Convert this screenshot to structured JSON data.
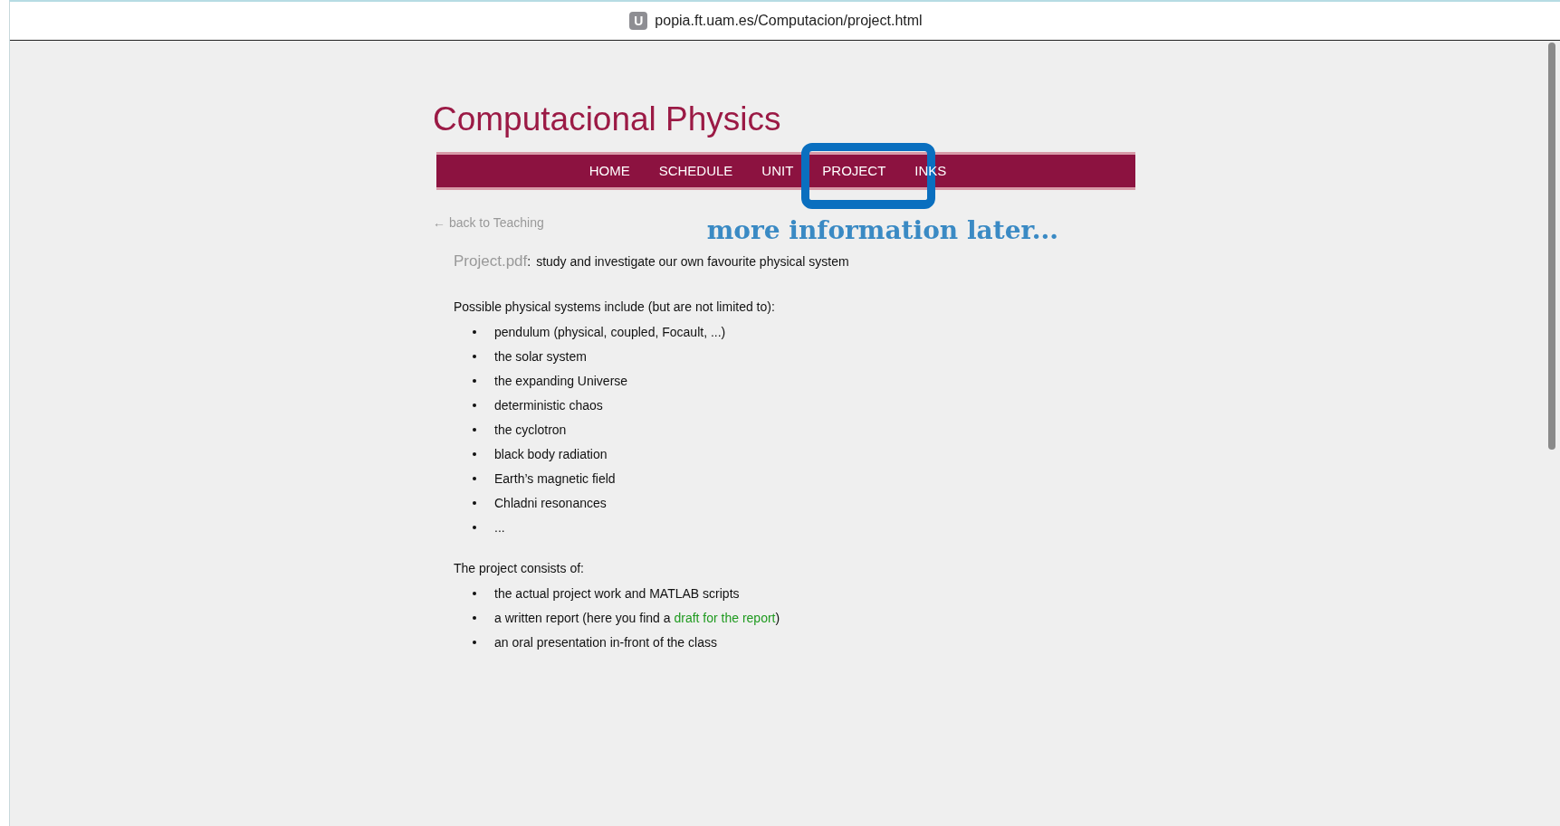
{
  "browser": {
    "url": "popia.ft.uam.es/Computacion/project.html",
    "site_badge": "U"
  },
  "page": {
    "title": "Computacional Physics",
    "nav": [
      "HOME",
      "SCHEDULE",
      "UNIT",
      "PROJECT",
      "INKS"
    ],
    "back_link": "← back to Teaching",
    "annotation": "more information later...",
    "intro": {
      "link": "Project.pdf",
      "separator": ":",
      "text": "study and investigate our own favourite physical system"
    },
    "systems_heading": "Possible physical systems include (but are not limited to):",
    "systems": [
      "pendulum (physical, coupled, Focault, ...)",
      "the solar system",
      "the expanding Universe",
      "deterministic chaos",
      "the cyclotron",
      "black body radiation",
      "Earth’s magnetic field",
      "Chladni resonances",
      "..."
    ],
    "consists_heading": "The project consists of:",
    "consists": [
      {
        "text": "the actual project work and MATLAB scripts"
      },
      {
        "text": "a written report (here you find a ",
        "link": "draft for the report",
        "after": ")"
      },
      {
        "text": "an oral presentation in-front of the class"
      }
    ]
  }
}
